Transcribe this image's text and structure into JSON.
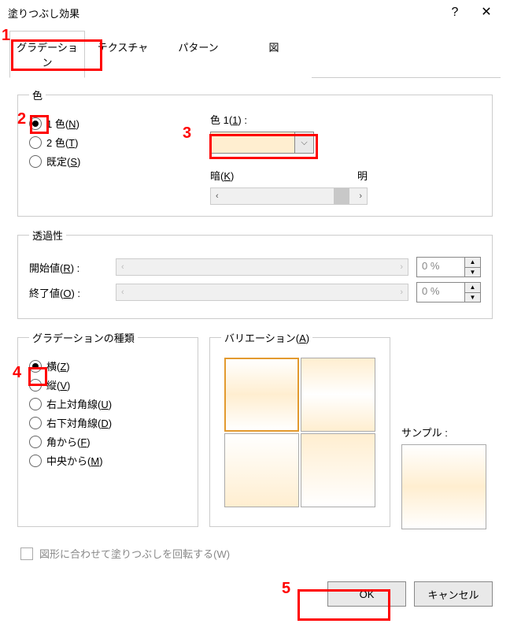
{
  "dialog": {
    "title": "塗りつぶし効果"
  },
  "tabs": {
    "gradient": "グラデーション",
    "texture": "テクスチャ",
    "pattern": "パターン",
    "picture": "図"
  },
  "colors": {
    "legend": "色",
    "one_color": "1 色(",
    "one_color_key": "N",
    "two_colors": "2 色(",
    "two_colors_key": "T",
    "preset": "既定(",
    "preset_key": "S",
    "close_paren": ")",
    "color1_label_pre": "色 1(",
    "color1_key": "1",
    "color1_label_post": ") :",
    "dark_pre": "暗(",
    "dark_key": "K",
    "dark_post": ")",
    "light": "明"
  },
  "transparency": {
    "legend": "透過性",
    "start_pre": "開始値(",
    "start_key": "R",
    "start_post": ") :",
    "end_pre": "終了値(",
    "end_key": "O",
    "end_post": ") :",
    "start_value": "0 %",
    "end_value": "0 %"
  },
  "shading": {
    "legend": "グラデーションの種類",
    "horizontal_pre": "横(",
    "horizontal_key": "Z",
    "vertical_pre": "縦(",
    "vertical_key": "V",
    "diag_up_pre": "右上対角線(",
    "diag_up_key": "U",
    "diag_down_pre": "右下対角線(",
    "diag_down_key": "D",
    "from_corner_pre": "角から(",
    "from_corner_key": "F",
    "from_center_pre": "中央から(",
    "from_center_key": "M",
    "close_paren": ")"
  },
  "variations": {
    "legend_pre": "バリエーション(",
    "legend_key": "A",
    "legend_post": ")"
  },
  "sample": {
    "label": "サンプル :"
  },
  "rotate": {
    "label": "図形に合わせて塗りつぶしを回転する(W)"
  },
  "footer": {
    "ok": "OK",
    "cancel": "キャンセル"
  },
  "annotations": {
    "n1": "1",
    "n2": "2",
    "n3": "3",
    "n4": "4",
    "n5": "5"
  }
}
